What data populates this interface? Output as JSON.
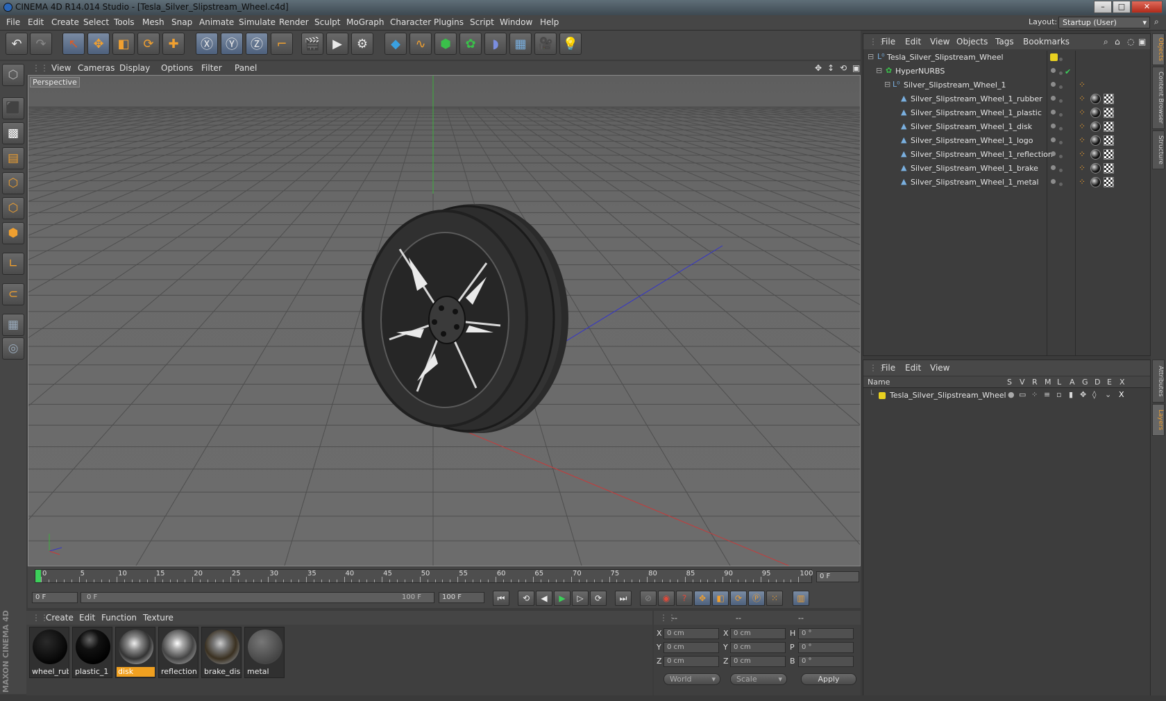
{
  "window": {
    "title": "CINEMA 4D R14.014 Studio - [Tesla_Silver_Slipstream_Wheel.c4d]"
  },
  "menu": [
    "File",
    "Edit",
    "Create",
    "Select",
    "Tools",
    "Mesh",
    "Snap",
    "Animate",
    "Simulate",
    "Render",
    "Sculpt",
    "MoGraph",
    "Character",
    "Plugins",
    "Script",
    "Window",
    "Help"
  ],
  "layout": {
    "label": "Layout:",
    "value": "Startup (User)"
  },
  "viewport": {
    "menu": [
      "View",
      "Cameras",
      "Display",
      "Options",
      "Filter",
      "Panel"
    ],
    "label": "Perspective"
  },
  "timeline": {
    "ticks": [
      "0",
      "5",
      "10",
      "15",
      "20",
      "25",
      "30",
      "35",
      "40",
      "45",
      "50",
      "55",
      "60",
      "65",
      "70",
      "75",
      "80",
      "85",
      "90",
      "95",
      "100"
    ],
    "current_frame": "0 F",
    "start": "0 F",
    "range_start": "0 F",
    "range_end": "100 F",
    "end": "100 F"
  },
  "materials": {
    "menu": [
      "Create",
      "Edit",
      "Function",
      "Texture"
    ],
    "items": [
      {
        "name": "wheel_rubl",
        "selected": false
      },
      {
        "name": "plastic_1",
        "selected": false
      },
      {
        "name": "disk",
        "selected": true
      },
      {
        "name": "reflection",
        "selected": false
      },
      {
        "name": "brake_disk",
        "selected": false
      },
      {
        "name": "metal",
        "selected": false
      }
    ]
  },
  "coordinates": {
    "headers": [
      "--",
      "--",
      "--"
    ],
    "rows": [
      {
        "a": "X",
        "av": "0 cm",
        "b": "X",
        "bv": "0 cm",
        "c": "H",
        "cv": "0 °"
      },
      {
        "a": "Y",
        "av": "0 cm",
        "b": "Y",
        "bv": "0 cm",
        "c": "P",
        "cv": "0 °"
      },
      {
        "a": "Z",
        "av": "0 cm",
        "b": "Z",
        "bv": "0 cm",
        "c": "B",
        "cv": "0 °"
      }
    ],
    "world": "World",
    "scale": "Scale",
    "apply": "Apply"
  },
  "objects_panel": {
    "menu": [
      "File",
      "Edit",
      "View",
      "Objects",
      "Tags",
      "Bookmarks"
    ],
    "items": [
      {
        "name": "Tesla_Silver_Slipstream_Wheel",
        "level": 0
      },
      {
        "name": "HyperNURBS",
        "level": 1
      },
      {
        "name": "Silver_Slipstream_Wheel_1",
        "level": 2
      },
      {
        "name": "Silver_Slipstream_Wheel_1_rubber",
        "level": 3
      },
      {
        "name": "Silver_Slipstream_Wheel_1_plastic",
        "level": 3
      },
      {
        "name": "Silver_Slipstream_Wheel_1_disk",
        "level": 3
      },
      {
        "name": "Silver_Slipstream_Wheel_1_logo",
        "level": 3
      },
      {
        "name": "Silver_Slipstream_Wheel_1_reflection",
        "level": 3
      },
      {
        "name": "Silver_Slipstream_Wheel_1_brake",
        "level": 3
      },
      {
        "name": "Silver_Slipstream_Wheel_1_metal",
        "level": 3
      }
    ]
  },
  "layers_panel": {
    "menu": [
      "File",
      "Edit",
      "View"
    ],
    "columns": [
      "Name",
      "S",
      "V",
      "R",
      "M",
      "L",
      "A",
      "G",
      "D",
      "E",
      "X"
    ],
    "rows": [
      {
        "name": "Tesla_Silver_Slipstream_Wheel",
        "color": "#e8d020"
      }
    ]
  },
  "right_tabs": [
    "Objects",
    "Content Browser",
    "Structure",
    "Attributes",
    "Layers"
  ],
  "brand": "MAXON CINEMA 4D"
}
